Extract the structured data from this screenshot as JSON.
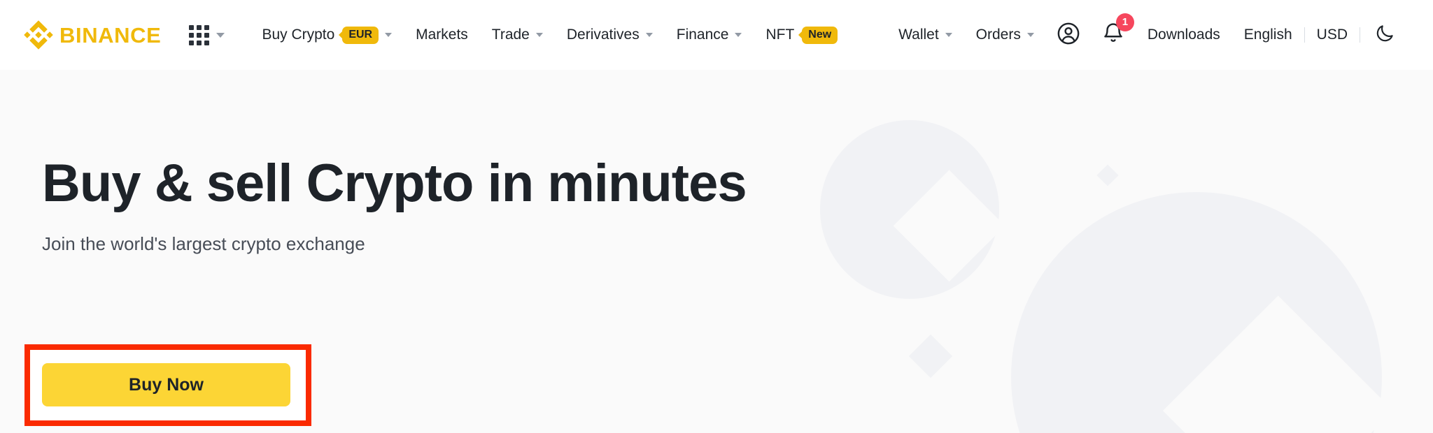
{
  "header": {
    "logo": {
      "icon": "binance-logo-icon",
      "text": "BINANCE",
      "color": "#F0B90B"
    },
    "apps_icon": "grid-apps-icon",
    "nav": [
      {
        "label": "Buy Crypto",
        "badge": "EUR",
        "has_caret": true
      },
      {
        "label": "Markets",
        "badge": null,
        "has_caret": false
      },
      {
        "label": "Trade",
        "badge": null,
        "has_caret": true
      },
      {
        "label": "Derivatives",
        "badge": null,
        "has_caret": true
      },
      {
        "label": "Finance",
        "badge": null,
        "has_caret": true
      },
      {
        "label": "NFT",
        "badge": "New",
        "has_caret": false
      }
    ],
    "right": {
      "wallet": "Wallet",
      "orders": "Orders",
      "profile_icon": "user-profile-icon",
      "bell_icon": "notification-bell-icon",
      "bell_count": "1",
      "bell_badge_color": "#F6465D",
      "downloads": "Downloads",
      "language": "English",
      "currency": "USD",
      "theme_icon": "moon-dark-mode-icon"
    }
  },
  "hero": {
    "title": "Buy & sell Crypto in minutes",
    "subtitle": "Join the world's largest crypto exchange",
    "cta_label": "Buy Now",
    "cta_color": "#FCD535",
    "annotation_color": "#FA2A00",
    "background": "#FAFAFA"
  }
}
